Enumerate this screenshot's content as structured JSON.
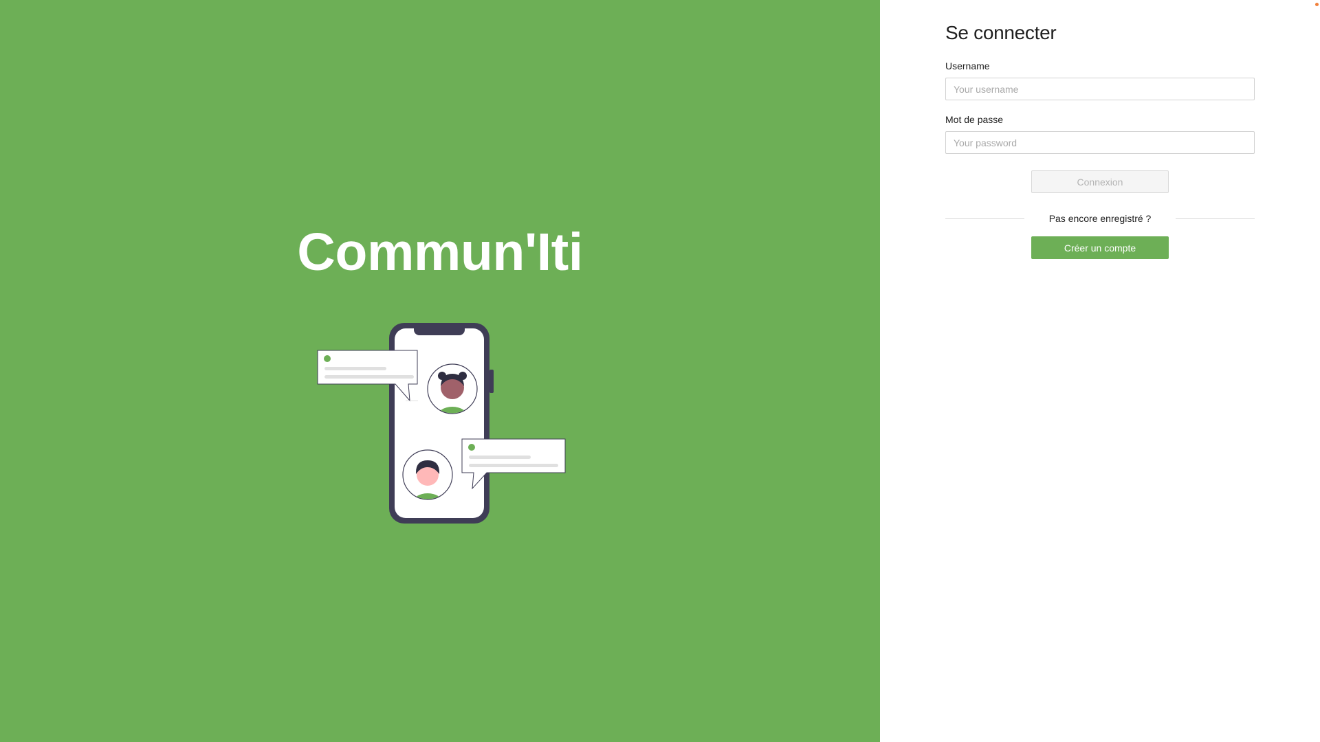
{
  "brand": {
    "app_name": "Commun'Iti",
    "accent_color": "#6daf56"
  },
  "login": {
    "title": "Se connecter",
    "username_label": "Username",
    "username_placeholder": "Your username",
    "username_value": "",
    "password_label": "Mot de passe",
    "password_placeholder": "Your password",
    "password_value": "",
    "login_button": "Connexion",
    "login_button_state": "disabled",
    "divider_text": "Pas encore enregistré ?",
    "create_account_button": "Créer un compte"
  },
  "illustration": {
    "icon": "phone-chat-illustration"
  }
}
